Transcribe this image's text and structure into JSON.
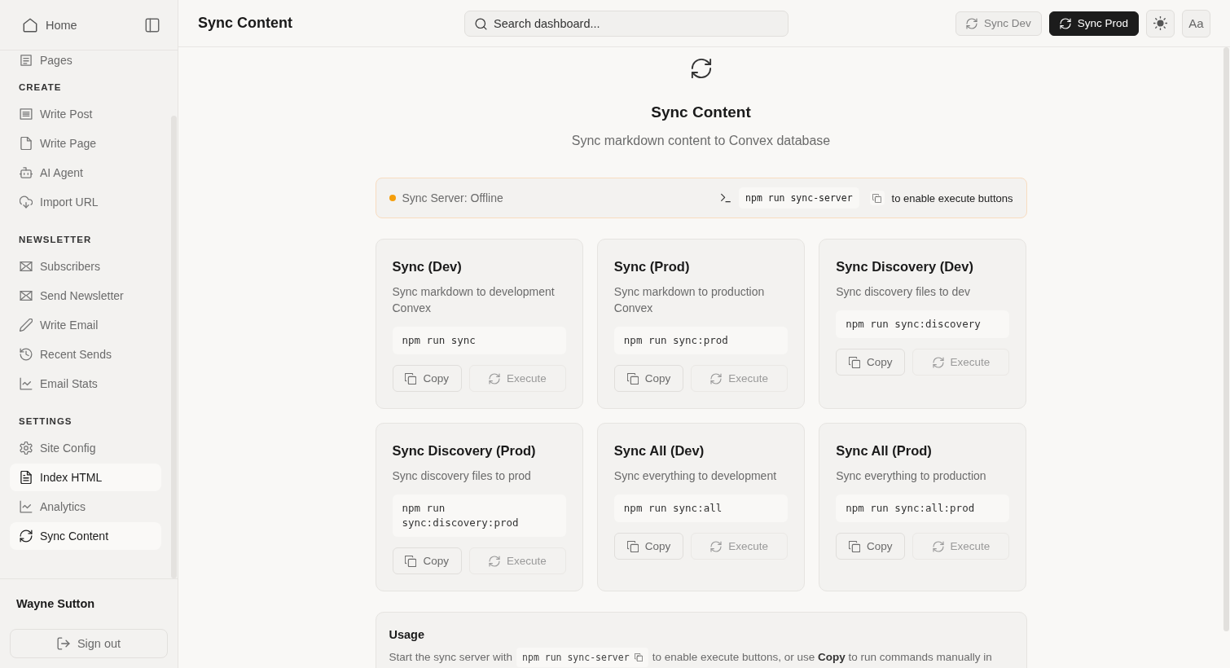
{
  "sidebar": {
    "home": "Home",
    "pages_item": "Pages",
    "sections": [
      {
        "title": "CREATE",
        "items": [
          {
            "label": "Write Post",
            "selected": false
          },
          {
            "label": "Write Page",
            "selected": false
          },
          {
            "label": "AI Agent",
            "selected": false
          },
          {
            "label": "Import URL",
            "selected": false
          }
        ]
      },
      {
        "title": "NEWSLETTER",
        "items": [
          {
            "label": "Subscribers",
            "selected": false
          },
          {
            "label": "Send Newsletter",
            "selected": false
          },
          {
            "label": "Write Email",
            "selected": false
          },
          {
            "label": "Recent Sends",
            "selected": false
          },
          {
            "label": "Email Stats",
            "selected": false
          }
        ]
      },
      {
        "title": "SETTINGS",
        "items": [
          {
            "label": "Site Config",
            "selected": false
          },
          {
            "label": "Index HTML",
            "selected": true
          },
          {
            "label": "Analytics",
            "selected": false
          },
          {
            "label": "Sync Content",
            "selected": true
          }
        ]
      }
    ],
    "user": "Wayne Sutton",
    "sign_out": "Sign out"
  },
  "header": {
    "title": "Sync Content",
    "search": {
      "placeholder": "Search dashboard..."
    },
    "buttons": [
      {
        "label": "Sync Dev",
        "kind": "secondary"
      },
      {
        "label": "Sync Prod",
        "kind": "primary"
      }
    ],
    "font_button": "Aa"
  },
  "page": {
    "title": "Sync Content",
    "subtitle": "Sync markdown content to Convex database"
  },
  "server_status": {
    "label": "Sync Server: Offline",
    "online": false,
    "command": "npm run sync-server",
    "hint": "to enable execute buttons"
  },
  "commands": [
    {
      "title": "Sync (Dev)",
      "description": "Sync markdown to development Convex",
      "command": "npm run sync",
      "copy": "Copy",
      "execute": {
        "label": "Execute",
        "disabled": true
      }
    },
    {
      "title": "Sync (Prod)",
      "description": "Sync markdown to production Convex",
      "command": "npm run sync:prod",
      "copy": "Copy",
      "execute": {
        "label": "Execute",
        "disabled": true
      }
    },
    {
      "title": "Sync Discovery (Dev)",
      "description": "Sync discovery files to dev",
      "command": "npm run sync:discovery",
      "copy": "Copy",
      "execute": {
        "label": "Execute",
        "disabled": true
      }
    },
    {
      "title": "Sync Discovery (Prod)",
      "description": "Sync discovery files to prod",
      "command": "npm run sync:discovery:prod",
      "copy": "Copy",
      "execute": {
        "label": "Execute",
        "disabled": true
      }
    },
    {
      "title": "Sync All (Dev)",
      "description": "Sync everything to development",
      "command": "npm run sync:all",
      "copy": "Copy",
      "execute": {
        "label": "Execute",
        "disabled": true
      }
    },
    {
      "title": "Sync All (Prod)",
      "description": "Sync everything to production",
      "command": "npm run sync:all:prod",
      "copy": "Copy",
      "execute": {
        "label": "Execute",
        "disabled": true
      }
    }
  ],
  "usage": {
    "title": "Usage",
    "before": "Start the sync server with",
    "command": "npm run sync-server",
    "after": "to enable execute buttons, or use **Copy** to run commands manually in"
  }
}
